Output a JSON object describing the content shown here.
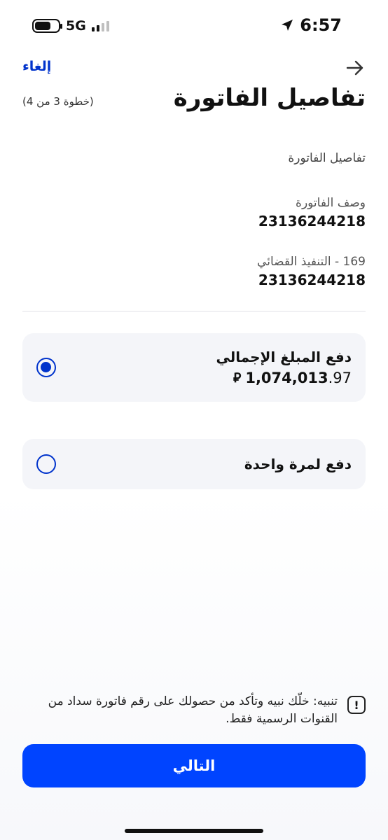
{
  "status_bar": {
    "network": "5G",
    "time": "6:57",
    "battery_level": 0.7,
    "signal_bars_active": 2,
    "icons": [
      "battery-icon",
      "signal-icon",
      "location-arrow-icon"
    ]
  },
  "header": {
    "cancel_label": "إلغاء",
    "back_icon": "arrow-right-icon",
    "title": "تفاصيل الفاتورة",
    "step_label": "(خطوة 3 من 4)"
  },
  "details": {
    "section_label": "تفاصيل الفاتورة",
    "fields": [
      {
        "label": "وصف الفاتورة",
        "value": "23136244218"
      },
      {
        "label": "169 - التنفيذ القضائي",
        "value": "23136244218"
      }
    ]
  },
  "payment_options": [
    {
      "label": "دفع المبلغ الإجمالي",
      "amount_integer": "1,074,013",
      "amount_decimal": ".97",
      "currency_symbol": "⃁",
      "selected": true
    },
    {
      "label": "دفع لمرة واحدة",
      "selected": false
    }
  ],
  "warning": {
    "icon": "exclamation-icon",
    "text": "تنبيه: خلّك نبيه وتأكد من حصولك على رقم فاتورة سداد من القنوات الرسمية فقط."
  },
  "footer": {
    "next_label": "التالي"
  },
  "colors": {
    "accent": "#0033cc",
    "button": "#0044ff",
    "card": "#f4f5f9"
  }
}
